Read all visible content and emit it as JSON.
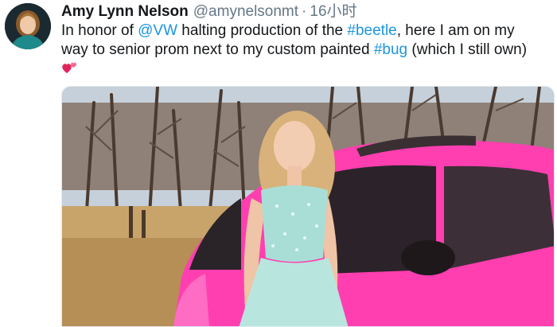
{
  "tweet": {
    "author_name": "Amy Lynn Nelson",
    "handle": "@amynelsonmt",
    "separator": "·",
    "timestamp": "16小时",
    "text": {
      "line1_pre": "In honor of ",
      "mention": "@VW",
      "line1_mid": " halting production of the ",
      "hashtag1": "#beetle",
      "line1_post": ", here I am on my",
      "line2_pre": "way to senior prom next to my custom painted ",
      "hashtag2": "#bug",
      "line2_post": " (which I still own)"
    },
    "emoji": "heart-icon"
  },
  "colors": {
    "link": "#1b95e0",
    "car_pink": "#ff3fb0",
    "dress": "#a9ded6"
  }
}
